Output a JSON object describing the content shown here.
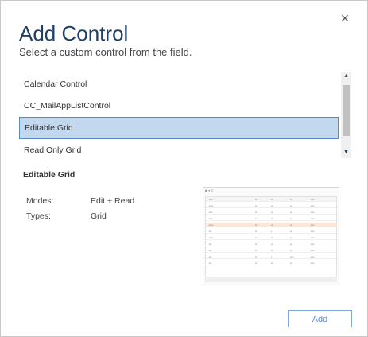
{
  "dialog": {
    "title": "Add Control",
    "subtitle": "Select a custom control from the field.",
    "close_icon": "×"
  },
  "controls": {
    "items": [
      {
        "label": "Calendar Control",
        "selected": false
      },
      {
        "label": "CC_MailAppListControl",
        "selected": false
      },
      {
        "label": "Editable Grid",
        "selected": true
      },
      {
        "label": "Read Only Grid",
        "selected": false
      }
    ],
    "scroll_up_icon": "▲",
    "scroll_down_icon": "▼"
  },
  "details": {
    "title": "Editable Grid",
    "modes_label": "Modes:",
    "modes_value": "Edit + Read",
    "types_label": "Types:",
    "types_value": "Grid"
  },
  "actions": {
    "add_label": "Add"
  },
  "colors": {
    "title": "#1e3f66",
    "selection_bg": "#c2d8ef",
    "selection_border": "#5a8ac6",
    "button_border": "#7da7dd",
    "button_text": "#5d8fcf"
  }
}
